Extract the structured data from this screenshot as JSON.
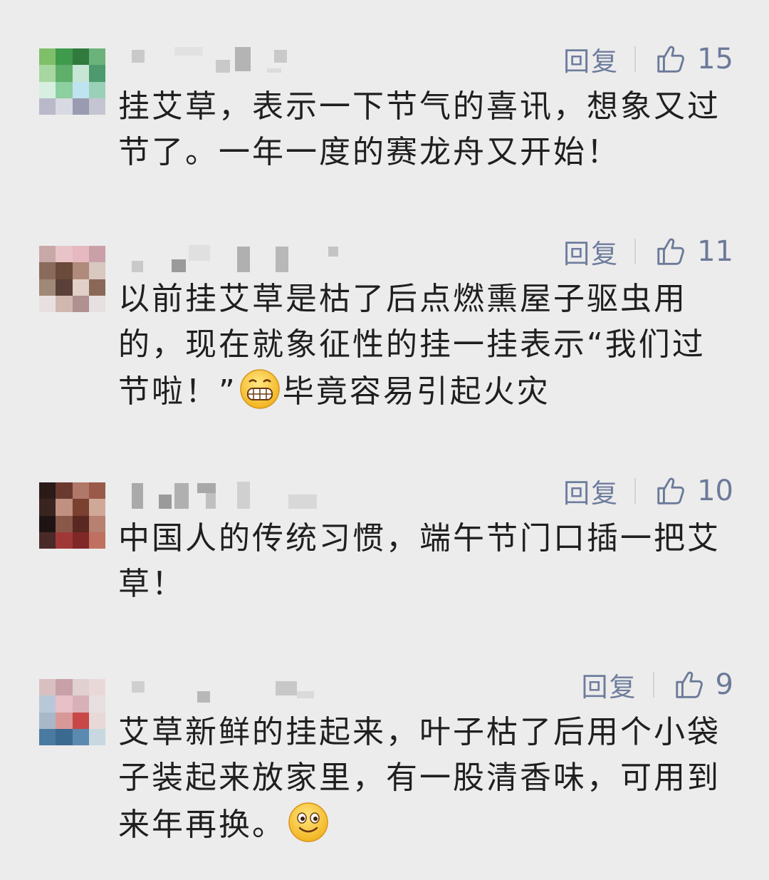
{
  "comments": [
    {
      "reply_label": "回复",
      "like_count": "15",
      "text": "挂艾草，表示一下节气的喜讯，想象又过节了。一年一度的赛龙舟又开始！"
    },
    {
      "reply_label": "回复",
      "like_count": "11",
      "text_before": "以前挂艾草是枯了后点燃熏屋子驱虫用的，现在就象征性的挂一挂表示“我们过节啦！”",
      "emoji": "grin-emoji",
      "text_after": "毕竟容易引起火灾"
    },
    {
      "reply_label": "回复",
      "like_count": "10",
      "text": "中国人的传统习惯，端午节门口插一把艾草！"
    },
    {
      "reply_label": "回复",
      "like_count": "9",
      "text_before": "艾草新鲜的挂起来，叶子枯了后用个小袋子装起来放家里，有一股清香味，可用到来年再换。",
      "emoji": "smile-emoji"
    }
  ],
  "colors": {
    "background": "#ececec",
    "action_text": "#6c7a99",
    "body_text": "#1f1f1f"
  }
}
